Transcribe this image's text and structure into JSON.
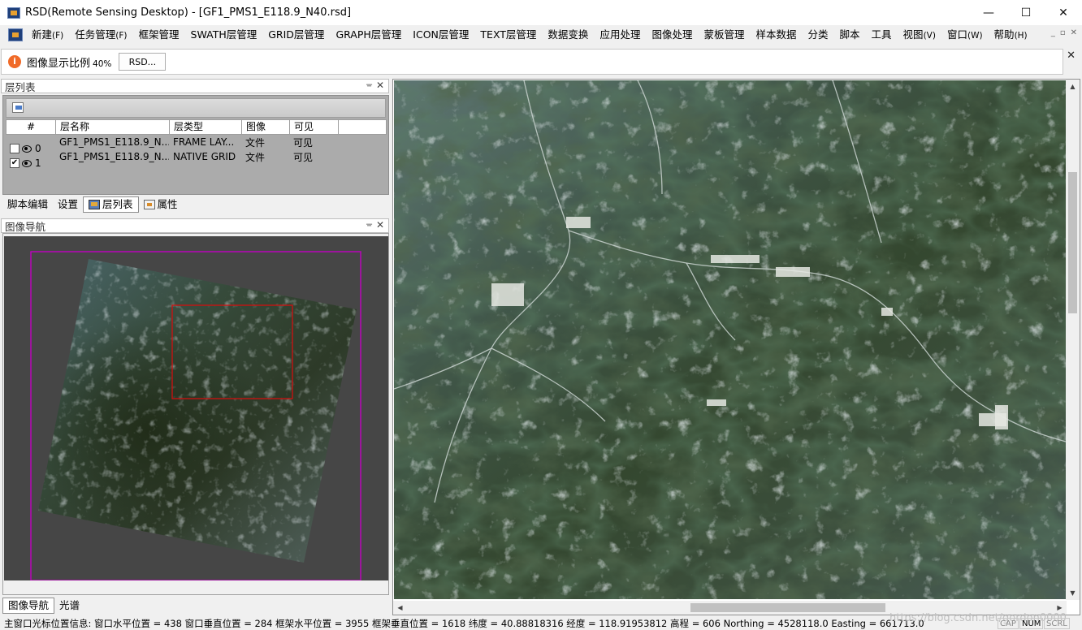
{
  "window": {
    "title": "RSD(Remote Sensing Desktop) - [GF1_PMS1_E118.9_N40.rsd]",
    "buttons": {
      "minimize": "—",
      "maximize": "☐",
      "close": "✕"
    }
  },
  "menubar": {
    "items": [
      {
        "label": "新建",
        "acc": "(F)"
      },
      {
        "label": "任务管理",
        "acc": "(F)"
      },
      {
        "label": "框架管理",
        "acc": ""
      },
      {
        "label": "SWATH层管理",
        "acc": ""
      },
      {
        "label": "GRID层管理",
        "acc": ""
      },
      {
        "label": "GRAPH层管理",
        "acc": ""
      },
      {
        "label": "ICON层管理",
        "acc": ""
      },
      {
        "label": "TEXT层管理",
        "acc": ""
      },
      {
        "label": "数据变换",
        "acc": ""
      },
      {
        "label": "应用处理",
        "acc": ""
      },
      {
        "label": "图像处理",
        "acc": ""
      },
      {
        "label": "蒙板管理",
        "acc": ""
      },
      {
        "label": "样本数据",
        "acc": ""
      },
      {
        "label": "分类",
        "acc": ""
      },
      {
        "label": "脚本",
        "acc": ""
      },
      {
        "label": "工具",
        "acc": ""
      },
      {
        "label": "视图",
        "acc": "(V)"
      },
      {
        "label": "窗口",
        "acc": "(W)"
      },
      {
        "label": "帮助",
        "acc": "(H)"
      }
    ],
    "mdi": {
      "minimize": "_",
      "restore": "▫",
      "close": "✕"
    }
  },
  "infobar": {
    "icon": "info-icon",
    "label": "图像显示比例",
    "scale": "40%",
    "button": "RSD...",
    "close": "✕"
  },
  "layer_panel": {
    "title": "层列表",
    "pin": "ᚚ",
    "close": "✕",
    "columns": [
      "#",
      "层名称",
      "层类型",
      "图像",
      "可见"
    ],
    "rows": [
      {
        "index": "0",
        "checked": false,
        "name": "GF1_PMS1_E118.9_N...",
        "type": "FRAME LAY...",
        "image": "文件",
        "visible": "可见"
      },
      {
        "index": "1",
        "checked": true,
        "name": "GF1_PMS1_E118.9_N...",
        "type": "NATIVE GRID",
        "image": "文件",
        "visible": "可见"
      }
    ]
  },
  "upper_tabs": {
    "items": [
      "脚本编辑",
      "设置",
      "层列表",
      "属性"
    ],
    "active": "层列表"
  },
  "navigator": {
    "title": "图像导航",
    "pin": "ᚚ",
    "close": "✕",
    "colors": {
      "frame": "#c000c0",
      "viewport": "#d01010",
      "background": "#464646"
    }
  },
  "lower_tabs": {
    "items": [
      "图像导航",
      "光谱"
    ],
    "active": "图像导航"
  },
  "main_view": {
    "scroll_up": "▲",
    "scroll_down": "▼",
    "scroll_left": "◀",
    "scroll_right": "▶"
  },
  "statusbar": {
    "text": "主窗口光标位置信息:  窗口水平位置 = 438 窗口垂直位置 = 284 框架水平位置 = 3955 框架垂直位置 = 1618 纬度 = 40.88818316 经度 = 118.91953812 高程 = 606 Northing = 4528118.0 Easting = 661713.0",
    "watermark": "https://blog.csdn.net/gordon0000",
    "indicators": [
      "CAP",
      "NUM",
      "SCRL"
    ]
  }
}
